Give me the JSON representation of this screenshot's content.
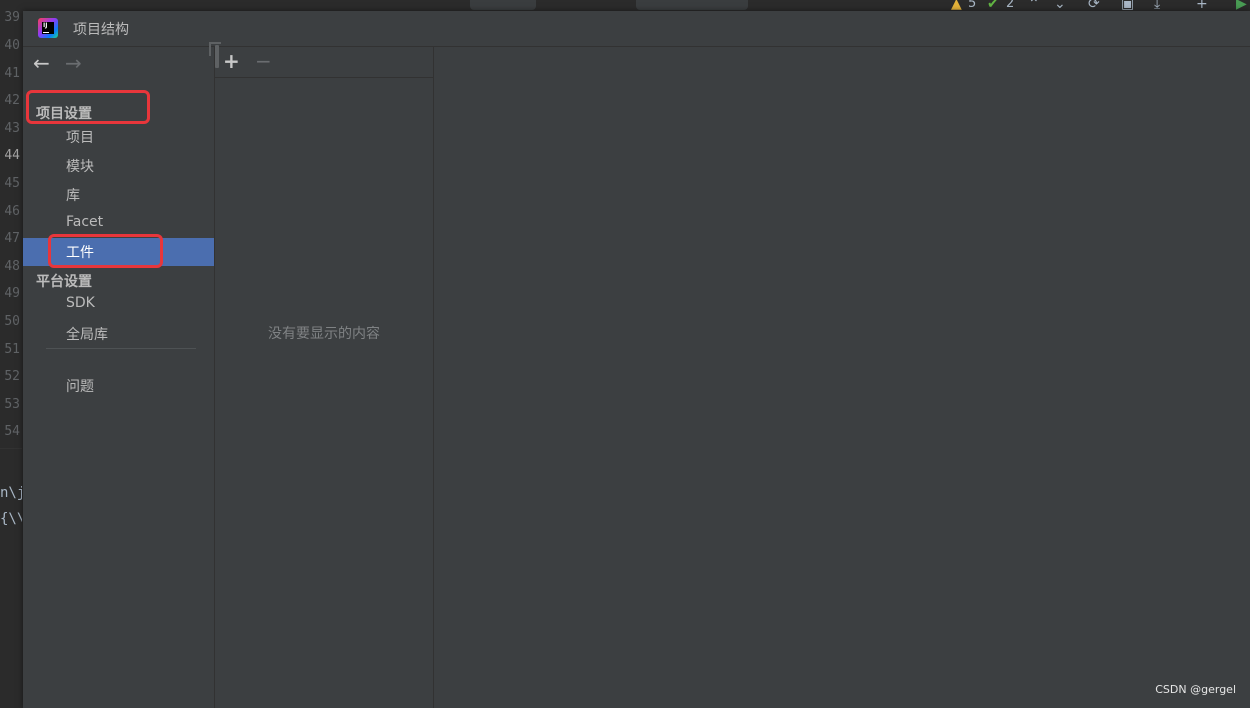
{
  "editor_background": {
    "line_numbers": [
      "39",
      "40",
      "41",
      "42",
      "43",
      "44",
      "45",
      "46",
      "47",
      "48",
      "49",
      "50",
      "51",
      "52",
      "53",
      "54"
    ],
    "current_line": "44",
    "code_fragments": [
      "n\\j",
      "{\\\\"
    ],
    "toolbar": {
      "warning_count": "5",
      "check_count": "2"
    }
  },
  "dialog": {
    "title": "项目结构",
    "sidebar": {
      "project_settings_title": "项目设置",
      "project_settings_items": [
        "项目",
        "模块",
        "库",
        "Facet",
        "工件"
      ],
      "selected_item": "工件",
      "platform_settings_title": "平台设置",
      "platform_settings_items": [
        "SDK",
        "全局库"
      ],
      "problems_item": "问题"
    },
    "middle_panel": {
      "empty_text": "没有要显示的内容"
    }
  },
  "watermark": "CSDN @gergel",
  "colors": {
    "selection": "#4b6eaf",
    "highlight_box": "#e8363b",
    "panel_bg": "#3c3f41",
    "editor_bg": "#2b2b2b"
  },
  "icons": {
    "back": "arrow-left-icon",
    "forward": "arrow-right-icon",
    "add": "plus-icon",
    "remove": "minus-icon",
    "copy": "copy-icon",
    "app": "intellij-idea-icon"
  }
}
